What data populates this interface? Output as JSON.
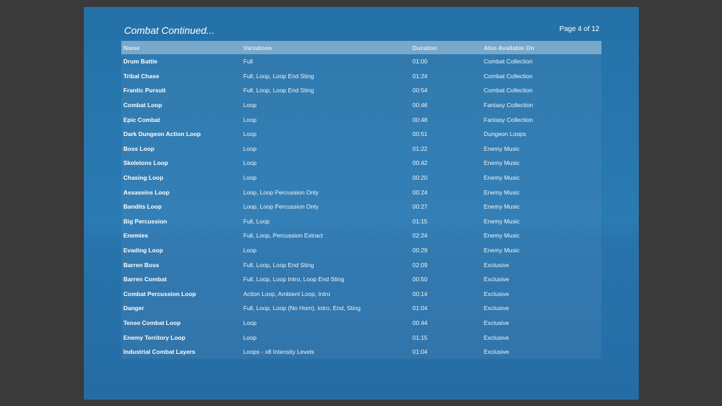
{
  "slide": {
    "title": "Combat Continued...",
    "page_indicator": "Page 4 of 12"
  },
  "table": {
    "headers": [
      "Name",
      "Variations",
      "Duration",
      "Also Available On"
    ],
    "rows": [
      [
        "Drum Battle",
        "Full",
        "01:00",
        "Combat Collection"
      ],
      [
        "Tribal Chase",
        "Full, Loop, Loop End Sting",
        "01:24",
        "Combat Collection"
      ],
      [
        "Frantic Pursuit",
        "Full, Loop, Loop End Sting",
        "00:54",
        "Combat Collection"
      ],
      [
        "Combat Loop",
        "Loop",
        "00:46",
        "Fantasy Collection"
      ],
      [
        "Epic Combat",
        "Loop",
        "00:48",
        "Fantasy Collection"
      ],
      [
        "Dark Dungeon Action Loop",
        "Loop",
        "00:51",
        "Dungeon Loops"
      ],
      [
        "Boss Loop",
        "Loop",
        "01:22",
        "Enemy Music"
      ],
      [
        "Skeletons Loop",
        "Loop",
        "00:42",
        "Enemy Music"
      ],
      [
        "Chasing Loop",
        "Loop",
        "00:20",
        "Enemy Music"
      ],
      [
        "Assassins Loop",
        "Loop, Loop Percussion Only",
        "00:24",
        "Enemy Music"
      ],
      [
        "Bandits Loop",
        "Loop, Loop Percussion Only",
        "00:27",
        "Enemy Music"
      ],
      [
        "Big Percussion",
        "Full, Loop",
        "01:15",
        "Enemy Music"
      ],
      [
        "Enemies",
        "Full, Loop, Percussion Extract",
        "02:24",
        "Enemy Music"
      ],
      [
        "Evading Loop",
        "Loop",
        "00:29",
        "Enemy Music"
      ],
      [
        "Barren Boss",
        "Full, Loop, Loop End Sting",
        "02:09",
        "Exclusive"
      ],
      [
        "Barren Combat",
        "Full, Loop, Loop Intro, Loop End Sting",
        "00:50",
        "Exclusive"
      ],
      [
        "Combat Percussion Loop",
        "Action Loop, Ambient Loop, Intro",
        "00:14",
        "Exclusive"
      ],
      [
        "Danger",
        "Full, Loop, Loop (No Horn), Intro, End, Sting",
        "01:04",
        "Exclusive"
      ],
      [
        "Tense Combat Loop",
        "Loop",
        "00:44",
        "Exclusive"
      ],
      [
        "Enemy Territory Loop",
        "Loop",
        "01:15",
        "Exclusive"
      ],
      [
        "Industrial Combat Layers",
        "Loops - x8 Intensity Levels",
        "01:04",
        "Exclusive"
      ]
    ]
  },
  "colors": {
    "frame_background": "#3a3a3a",
    "slide_background": "#2876b0",
    "header_row": "#5f97c4"
  }
}
